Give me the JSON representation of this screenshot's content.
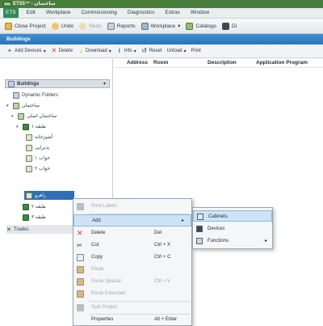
{
  "window": {
    "title": "ETS5™ - ساختمان"
  },
  "menubar": {
    "items": [
      "ETS",
      "Edit",
      "Workplace",
      "Commissioning",
      "Diagnostics",
      "Extras",
      "Window"
    ]
  },
  "toolbar": {
    "items": [
      {
        "label": "Close Project",
        "icon": "close-project-icon"
      },
      {
        "label": "Undo",
        "icon": "undo-icon"
      },
      {
        "label": "Redo",
        "icon": "redo-icon"
      },
      {
        "label": "Reports",
        "icon": "reports-icon"
      },
      {
        "label": "Workplace",
        "icon": "workplace-icon"
      },
      {
        "label": "Catalogs",
        "icon": "catalogs-icon"
      },
      {
        "label": "Di",
        "icon": "diagnostics-icon"
      }
    ]
  },
  "panel": {
    "title": "Buildings"
  },
  "subtoolbar": {
    "items": [
      {
        "label": "Add Devices",
        "icon": "+"
      },
      {
        "label": "Delete",
        "icon": "✕"
      },
      {
        "label": "Download",
        "icon": "↓"
      },
      {
        "label": "Info",
        "icon": "i"
      },
      {
        "label": "Reset",
        "icon": "↺"
      },
      {
        "label": "Unload",
        "icon": ""
      },
      {
        "label": "Print",
        "icon": ""
      }
    ]
  },
  "tree": {
    "header": "Buildings",
    "rows": [
      {
        "label": "Dynamic Folders",
        "icon": "folder",
        "expander": ""
      },
      {
        "label": "ساختمان",
        "icon": "building",
        "expander": "▾"
      },
      {
        "label": "ساختمان اصلی",
        "icon": "building",
        "expander": "▾"
      },
      {
        "label": "طبقه ۱",
        "icon": "floor",
        "expander": "▾"
      },
      {
        "label": "آشپزخانه",
        "icon": "room",
        "expander": ""
      },
      {
        "label": "پذیرایی",
        "icon": "room",
        "expander": ""
      },
      {
        "label": "خواب ۱",
        "icon": "room",
        "expander": ""
      },
      {
        "label": "خواب ۲",
        "icon": "room",
        "expander": ""
      },
      {
        "label": "راهرو",
        "icon": "room",
        "expander": "",
        "selected": true
      },
      {
        "label": "طبقه ۲",
        "icon": "floor",
        "expander": ""
      },
      {
        "label": "طبقه ۳",
        "icon": "floor",
        "expander": ""
      },
      {
        "label": "Trades",
        "icon": "trades",
        "expander": ""
      }
    ]
  },
  "grid": {
    "columns": [
      "Address",
      "Room",
      "Description",
      "Application Program"
    ]
  },
  "context_menu": {
    "items": [
      {
        "label": "Print Labels",
        "shortcut": "",
        "disabled": true,
        "submenu": false
      },
      {
        "label": "Add",
        "shortcut": "",
        "disabled": false,
        "submenu": true,
        "hover": true
      },
      {
        "label": "Delete",
        "shortcut": "Del",
        "disabled": false,
        "submenu": false
      },
      {
        "label": "Cut",
        "shortcut": "Ctrl + X",
        "disabled": false,
        "submenu": false
      },
      {
        "label": "Copy",
        "shortcut": "Ctrl + C",
        "disabled": false,
        "submenu": false
      },
      {
        "label": "Paste",
        "shortcut": "",
        "disabled": true,
        "submenu": false
      },
      {
        "label": "Paste Special",
        "shortcut": "Ctrl + V",
        "disabled": true,
        "submenu": false
      },
      {
        "label": "Paste Extended",
        "shortcut": "",
        "disabled": true,
        "submenu": false
      },
      {
        "label": "Split Project",
        "shortcut": "",
        "disabled": true,
        "submenu": false
      },
      {
        "label": "Properties",
        "shortcut": "Alt + Enter",
        "disabled": false,
        "submenu": false
      }
    ]
  },
  "sub_menu": {
    "items": [
      {
        "label": "Cabinets",
        "submenu": false,
        "hover": true
      },
      {
        "label": "Devices",
        "submenu": false
      },
      {
        "label": "Functions",
        "submenu": true
      }
    ]
  },
  "colors": {
    "title_bar": "#4a7d3e",
    "panel_header": "#2b74b8",
    "selection": "#2f6fb5",
    "menu_hover": "#cfe3f6"
  }
}
